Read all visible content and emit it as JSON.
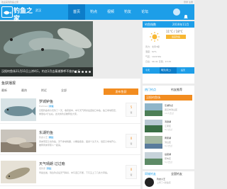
{
  "topbar": {
    "left": "欢迎来到钓鱼之家",
    "right": "登录 注册"
  },
  "header": {
    "logo_text": "钓鱼之家",
    "location": "武汉",
    "nav": [
      "首页",
      "钓点",
      "视频",
      "钓友",
      "论坛"
    ],
    "colors": {
      "brand": "#1d9ee8",
      "brand_dark": "#0d7dc9",
      "accent": "#f28c20"
    }
  },
  "hero": {
    "caption": "汉阳钓鱼场11月11日上岸4斤，钓点1月吉泰湖那呼不准价三斤",
    "slides": 5,
    "active_slide": 1
  },
  "feed": {
    "title": "鱼获播报",
    "filters": [
      "最新",
      "最热",
      "附近",
      "全部"
    ],
    "post_button": "发布鱼获",
    "items": [
      {
        "title": "罗城鲈鱼",
        "user": "Fishman",
        "tag": "鲈鱼",
        "desc": "汉阳钓鱼场今天钓了一天，收获颇丰，中午天气转好后连续口中鱼，鱼口非常稳定，重量在2斤左右，这次的钓点推荐给大家。",
        "votes": "5",
        "vote_label": "赞"
      },
      {
        "title": "东湖钓鱼",
        "user": "钓友小王",
        "tag": "鲫鱼",
        "desc": "周末带孩子去钓鱼，天气非常晴朗，小鲫鱼很多，虽然个头不大，但孩子非常开心，推荐周末带家人一起来。",
        "votes": "0",
        "vote_label": "赞"
      },
      {
        "title": "天气晴朗 过过瘾",
        "user": "老钓手",
        "tag": "草鱼",
        "desc": "早晨出发，到达钓点后天气晴好，中午连口不断，下午又上了几条大草鱼。",
        "votes": "0",
        "vote_label": "赞"
      }
    ]
  },
  "weather": {
    "header_left": "钓鱼指数",
    "header_right": "2016年11月",
    "temp": "11°C / 18°C",
    "badge": "适宜钓鱼",
    "rows": [
      "风力：北风3级",
      "湿度：62%",
      "气压：1021hPa",
      "日出：06:41 日落：17:25"
    ],
    "bar": [
      "今天",
      "明天(周二)",
      "后天"
    ]
  },
  "hot": {
    "tab_active": "热门钓点",
    "tab_other": "钓友推荐",
    "first": "汉阳钓鱼场",
    "rows": [
      {
        "title": "东湖钓点",
        "sub": "武汉市洪山区",
        "meta": "12人去过"
      },
      {
        "title": "汤逊湖",
        "sub": "江夏区",
        "meta": "8人去过"
      },
      {
        "title": "黄家湖",
        "sub": "洪山区",
        "meta": "6人去过"
      },
      {
        "title": "后官湖",
        "sub": "蔡甸区",
        "meta": "5人去过"
      }
    ]
  },
  "share": {
    "tab_active": "同城钓友",
    "tab_other": "全国钓友",
    "name": "钓友小王",
    "sub": "上传了1张鱼获"
  }
}
